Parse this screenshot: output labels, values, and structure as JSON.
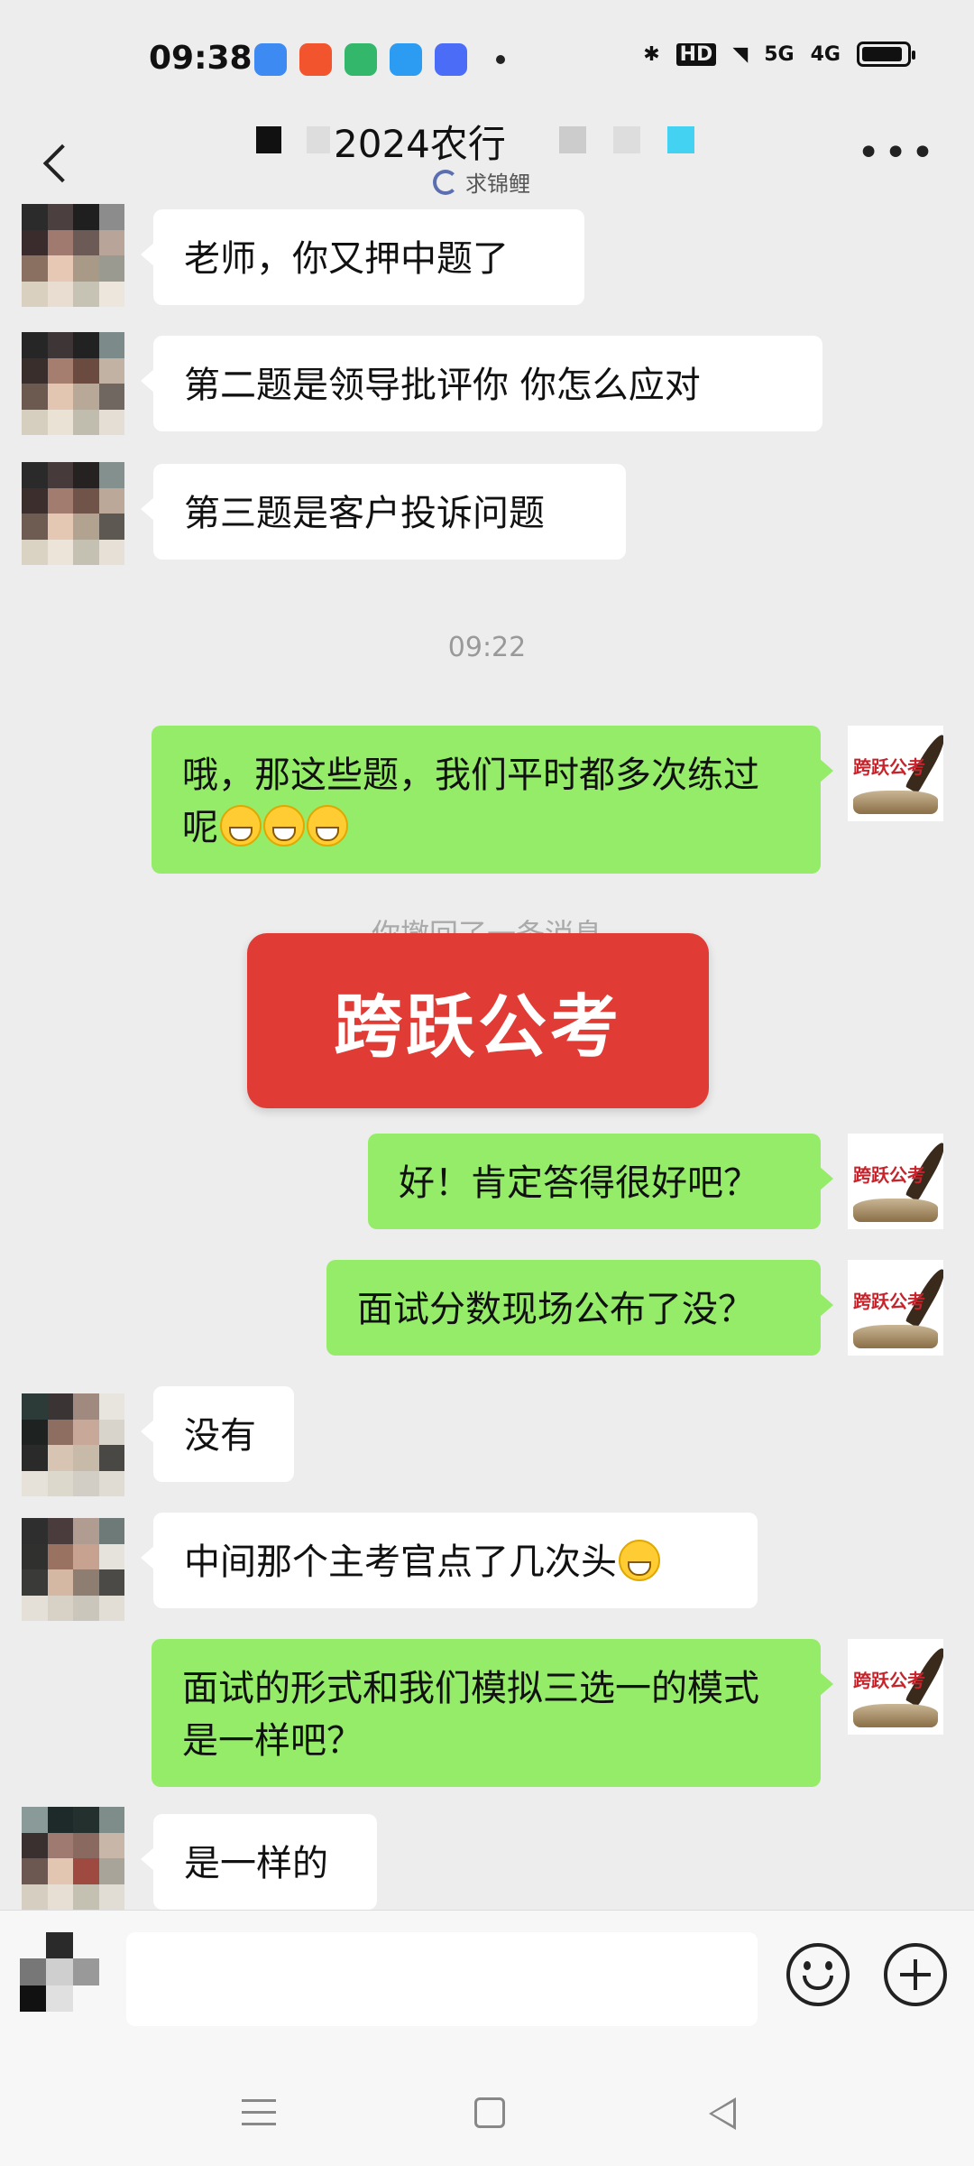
{
  "status_bar": {
    "time": "09:38",
    "hd": "HD",
    "net1": "5G",
    "net2": "4G"
  },
  "header": {
    "title": "2024农行",
    "subtitle": "求锦鲤"
  },
  "messages": [
    {
      "side": "left",
      "text": "老师，你又押中题了"
    },
    {
      "side": "left",
      "text": "第二题是领导批评你 你怎么应对"
    },
    {
      "side": "left",
      "text": "第三题是客户投诉问题"
    },
    {
      "side": "right",
      "text": "哦，那这些题，我们平时都多次练过呢"
    },
    {
      "side": "right",
      "text": "好！肯定答得很好吧？"
    },
    {
      "side": "right",
      "text": "面试分数现场公布了没？"
    },
    {
      "side": "left",
      "text": "没有"
    },
    {
      "side": "left",
      "text": "中间那个主考官点了几次头"
    },
    {
      "side": "right",
      "text": "面试的形式和我们模拟三选一的模式是一样吧？"
    },
    {
      "side": "left",
      "text": "是一样的"
    }
  ],
  "timestamp": "09:22",
  "recall_notice": "你撤回了一条消息",
  "sticker_text": "跨跃公考",
  "my_avatar_brand": "跨跃公考",
  "emoji_icon": "grinning-face-emoji"
}
